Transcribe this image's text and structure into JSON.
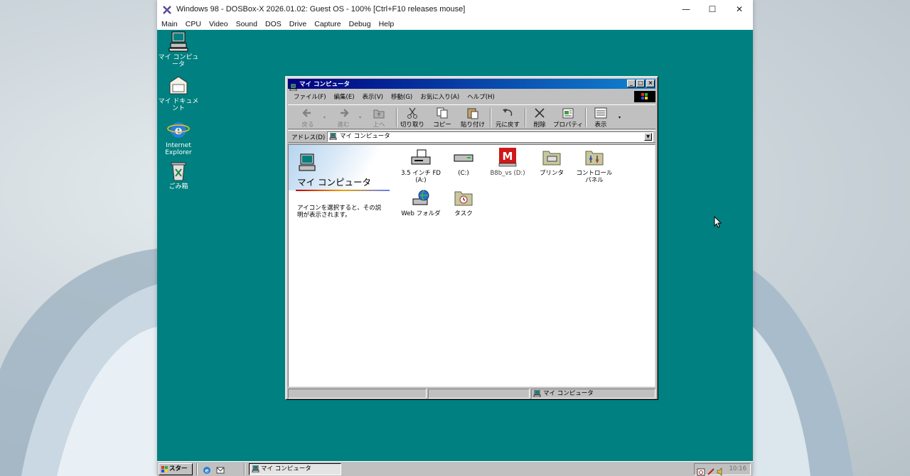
{
  "host_window": {
    "title": "Windows 98 - DOSBox-X 2026.01.02: Guest OS - 100% [Ctrl+F10 releases mouse]",
    "controls": {
      "minimize": "—",
      "maximize": "☐",
      "close": "✕"
    },
    "menu": [
      "Main",
      "CPU",
      "Video",
      "Sound",
      "DOS",
      "Drive",
      "Capture",
      "Debug",
      "Help"
    ]
  },
  "desktop": {
    "icons": [
      {
        "label": "マイ コンピュータ",
        "icon": "my-computer-icon"
      },
      {
        "label": "マイ ドキュメント",
        "icon": "my-documents-icon"
      },
      {
        "label": "Internet\nExplorer",
        "icon": "internet-explorer-icon"
      },
      {
        "label": "ごみ箱",
        "icon": "recycle-bin-icon"
      }
    ]
  },
  "explorer": {
    "title": "マイ コンピュータ",
    "menu": [
      "ファイル(F)",
      "編集(E)",
      "表示(V)",
      "移動(G)",
      "お気に入り(A)",
      "ヘルプ(H)"
    ],
    "toolbar": {
      "back": "戻る",
      "forward": "進む",
      "up": "上へ",
      "cut": "切り取り",
      "copy": "コピー",
      "paste": "貼り付け",
      "undo": "元に戻す",
      "delete": "削除",
      "properties": "プロパティ",
      "views": "表示"
    },
    "address": {
      "label": "アドレス(D)",
      "value": "マイ コンピュータ"
    },
    "panel": {
      "title": "マイ コンピュータ",
      "description": "アイコンを選択すると、その説明が表示されます。"
    },
    "items": [
      {
        "label": "3.5 インチ FD\n(A:)",
        "icon": "floppy-drive-icon"
      },
      {
        "label": "(C:)",
        "icon": "hard-drive-icon"
      },
      {
        "label": "B8b_vs (D:)",
        "icon": "cd-drive-icon"
      },
      {
        "label": "プリンタ",
        "icon": "printers-folder-icon"
      },
      {
        "label": "コントロール\nパネル",
        "icon": "control-panel-icon"
      },
      {
        "label": "Web フォルダ",
        "icon": "web-folders-icon"
      },
      {
        "label": "タスク",
        "icon": "scheduled-tasks-icon"
      }
    ],
    "status": {
      "right": "マイ コンピュータ"
    }
  },
  "taskbar": {
    "start_label": "スタート",
    "task_label": "マイ コンピュータ",
    "clock": "10:16"
  },
  "colors": {
    "desktop_teal": "#008080",
    "title_active_start": "#000080",
    "title_active_end": "#1084d0",
    "win98_face": "#c0c0c0"
  }
}
